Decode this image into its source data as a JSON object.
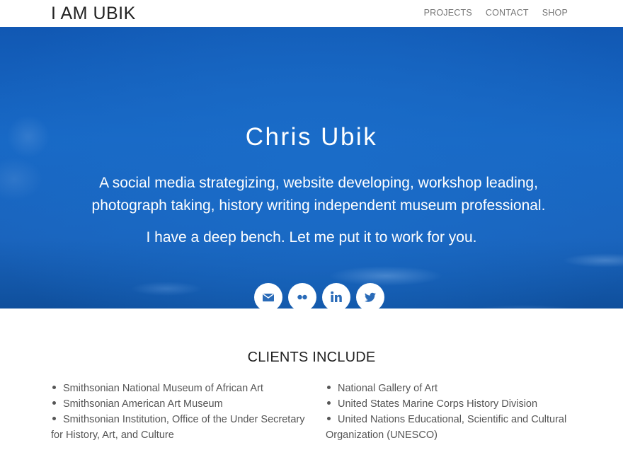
{
  "header": {
    "logo": "I AM UBIK",
    "nav": [
      "PROJECTS",
      "CONTACT",
      "SHOP"
    ]
  },
  "hero": {
    "name": "Chris Ubik",
    "tagline": "A social media strategizing, website developing, workshop leading, photograph taking, history writing independent museum professional.",
    "subtagline": "I have a deep bench. Let me put it to work for you.",
    "social_icons": [
      "mail-icon",
      "flickr-icon",
      "linkedin-icon",
      "twitter-icon"
    ],
    "colors": {
      "hero_blue": "#1869c6",
      "icon_blue": "#2a6bb8"
    }
  },
  "clients": {
    "heading": "CLIENTS INCLUDE",
    "left": [
      "Smithsonian National Museum of African Art",
      "Smithsonian American Art Museum",
      "Smithsonian Institution, Office of the Under Secretary for History, Art, and Culture"
    ],
    "right": [
      "National Gallery of Art",
      "United States Marine Corps History Division",
      "United Nations Educational, Scientific and Cultural Organization (UNESCO)"
    ]
  }
}
